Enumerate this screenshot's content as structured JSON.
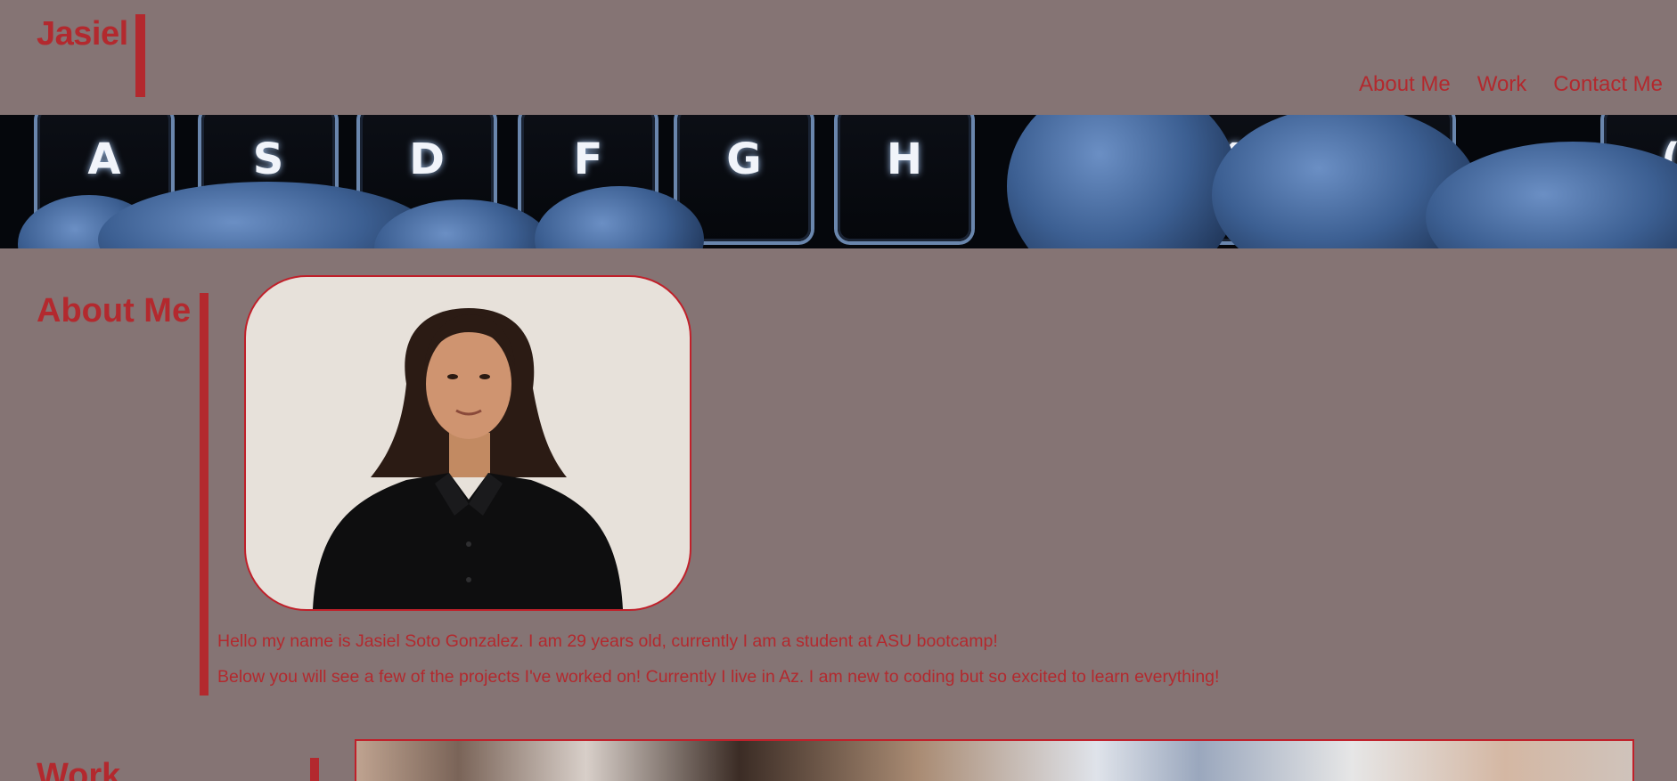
{
  "header": {
    "logo": "Jasiel",
    "nav": [
      {
        "label": "About Me"
      },
      {
        "label": "Work"
      },
      {
        "label": "Contact Me"
      }
    ]
  },
  "hero": {
    "keys": [
      "A",
      "S",
      "D",
      "F",
      "G",
      "H",
      "K",
      "?",
      "("
    ]
  },
  "about": {
    "title": "About Me",
    "paragraphs": [
      "Hello my name is Jasiel Soto Gonzalez. I am 29 years old, currently I am a student at ASU bootcamp!",
      "Below you will see a few of the projects I've worked on! Currently I live in Az. I am new to coding but so excited to learn everything!"
    ]
  },
  "work": {
    "title": "Work"
  },
  "colors": {
    "background": "#857474",
    "accent": "#b3292e",
    "portrait_bg": "#e7e1da"
  }
}
